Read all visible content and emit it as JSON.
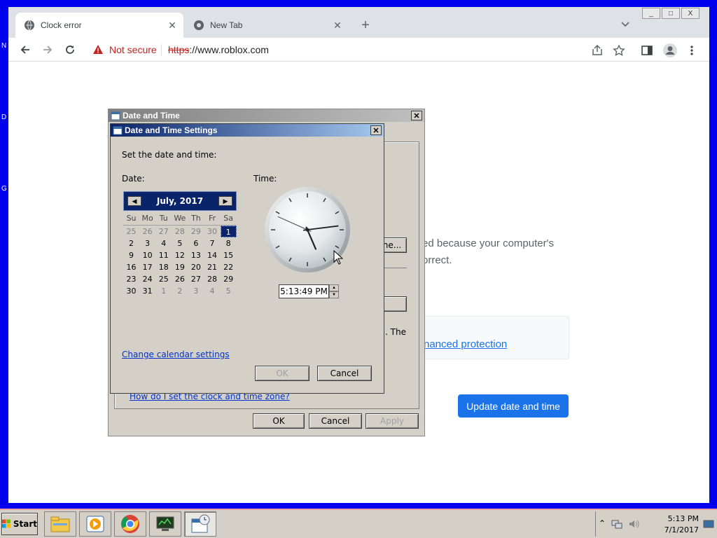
{
  "desktop": {
    "left_letters": [
      "N",
      "D",
      "G"
    ]
  },
  "browser": {
    "tabs": [
      {
        "title": "Clock error",
        "active": true
      },
      {
        "title": "New Tab",
        "active": false
      }
    ],
    "new_tab_symbol": "+",
    "window_controls": [
      "_",
      "□",
      "X"
    ],
    "address": {
      "security_label": "Not secure",
      "url_scheme": "https",
      "url_rest": "://www.roblox.com"
    },
    "page": {
      "body_line1": "ed because your computer's",
      "body_line2": "orrect.",
      "protection_link": "nanced protection",
      "update_button": "Update date and time"
    },
    "colors": {
      "accent": "#1a73e8",
      "danger": "#c5221f"
    }
  },
  "date_time_dialog": {
    "title": "Date and Time",
    "change_button_partial": "ne...",
    "partial_text": ". The",
    "help_link": "How do I set the clock and time zone?",
    "buttons": {
      "ok": "OK",
      "cancel": "Cancel",
      "apply": "Apply"
    }
  },
  "settings_dialog": {
    "title": "Date and Time Settings",
    "instruction": "Set the date and time:",
    "date_label": "Date:",
    "time_label": "Time:",
    "calendar": {
      "month_label": "July, 2017",
      "weekdays": [
        "Su",
        "Mo",
        "Tu",
        "We",
        "Th",
        "Fr",
        "Sa"
      ],
      "weeks": [
        [
          {
            "d": "25",
            "dim": true
          },
          {
            "d": "26",
            "dim": true
          },
          {
            "d": "27",
            "dim": true
          },
          {
            "d": "28",
            "dim": true
          },
          {
            "d": "29",
            "dim": true
          },
          {
            "d": "30",
            "dim": true
          },
          {
            "d": "1",
            "sel": true
          }
        ],
        [
          {
            "d": "2"
          },
          {
            "d": "3"
          },
          {
            "d": "4"
          },
          {
            "d": "5"
          },
          {
            "d": "6"
          },
          {
            "d": "7"
          },
          {
            "d": "8"
          }
        ],
        [
          {
            "d": "9"
          },
          {
            "d": "10"
          },
          {
            "d": "11"
          },
          {
            "d": "12"
          },
          {
            "d": "13"
          },
          {
            "d": "14"
          },
          {
            "d": "15"
          }
        ],
        [
          {
            "d": "16"
          },
          {
            "d": "17"
          },
          {
            "d": "18"
          },
          {
            "d": "19"
          },
          {
            "d": "20"
          },
          {
            "d": "21"
          },
          {
            "d": "22"
          }
        ],
        [
          {
            "d": "23"
          },
          {
            "d": "24"
          },
          {
            "d": "25"
          },
          {
            "d": "26"
          },
          {
            "d": "27"
          },
          {
            "d": "28"
          },
          {
            "d": "29"
          }
        ],
        [
          {
            "d": "30"
          },
          {
            "d": "31"
          },
          {
            "d": "1",
            "dim": true
          },
          {
            "d": "2",
            "dim": true
          },
          {
            "d": "3",
            "dim": true
          },
          {
            "d": "4",
            "dim": true
          },
          {
            "d": "5",
            "dim": true
          }
        ]
      ]
    },
    "time_value": "5:13:49 PM",
    "clock": {
      "hour": 5,
      "minute": 13,
      "second": 49
    },
    "calendar_link": "Change calendar settings",
    "buttons": {
      "ok": "OK",
      "cancel": "Cancel"
    }
  },
  "taskbar": {
    "start_label": "Start",
    "apps": [
      "file-explorer-icon",
      "media-player-icon",
      "chrome-icon",
      "network-icon",
      "date-time-icon"
    ],
    "tray_time": "5:13 PM",
    "tray_date": "7/1/2017"
  }
}
